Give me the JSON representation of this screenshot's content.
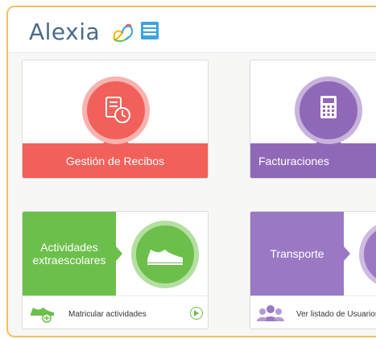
{
  "brand": {
    "name": "Alexia",
    "accent": "#3aa3e3",
    "frame_color": "#f3c063"
  },
  "modules": [
    {
      "label": "Gestión de Recibos",
      "icon": "receipt-clock-icon",
      "color": "#f2605a"
    },
    {
      "label": "Facturaciones",
      "icon": "calculator-icon",
      "color": "#9068b8"
    }
  ],
  "wide_modules": [
    {
      "label": "Actividades extraescolares",
      "icon": "sneaker-icon",
      "color": "#6cbf4a",
      "footer": "Matricular actividades",
      "footer_icon": "sneaker-add-icon"
    },
    {
      "label": "Transporte",
      "icon": "bus-icon",
      "color": "#9a78c4",
      "footer": "Ver listado de Usuarios",
      "footer_icon": "users-group-icon"
    }
  ]
}
